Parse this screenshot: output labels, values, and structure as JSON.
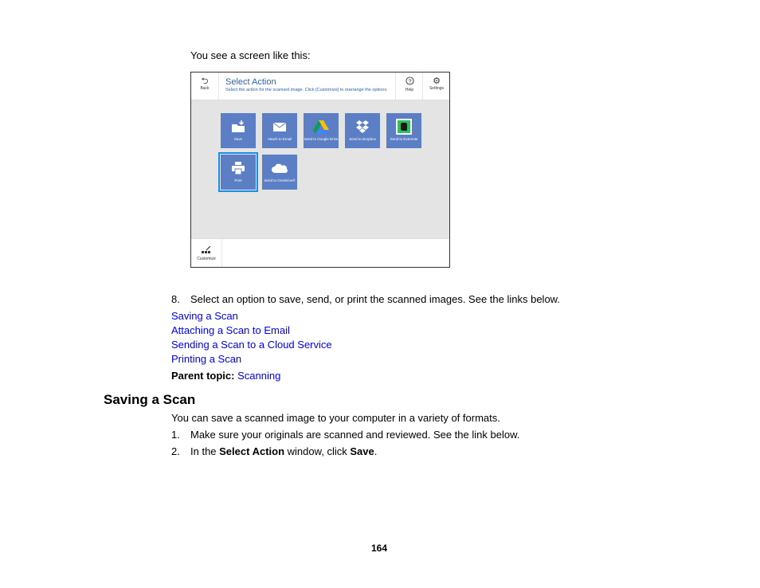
{
  "intro_text": "You see a screen like this:",
  "app": {
    "back_label": "Back",
    "title": "Select Action",
    "subtitle": "Select the action for the scanned image. Click [Customize] to rearrange the options.",
    "help_label": "Help",
    "settings_label": "Settings",
    "customize_label": "Customize",
    "icons": {
      "back": "back-arrow-icon",
      "help": "question-circle-icon",
      "settings": "gear-icon",
      "customize": "customize-icon"
    },
    "tile_color": "#5b7ec4",
    "selected_outline_color": "#1a8fe6",
    "actions": [
      {
        "label": "Save",
        "icon": "folder-add-icon",
        "selected": false
      },
      {
        "label": "Attach to Email",
        "icon": "envelope-icon",
        "selected": false
      },
      {
        "label": "Send to Google Drive",
        "icon": "google-drive-icon",
        "selected": false
      },
      {
        "label": "Send to Dropbox",
        "icon": "dropbox-icon",
        "selected": false
      },
      {
        "label": "Send to Evernote",
        "icon": "evernote-icon",
        "selected": false
      },
      {
        "label": "Print",
        "icon": "printer-icon",
        "selected": true
      },
      {
        "label": "Send to OneDrive®",
        "icon": "onedrive-cloud-icon",
        "selected": false
      }
    ]
  },
  "step8": {
    "number": "8.",
    "text": "Select an option to save, send, or print the scanned images. See the links below."
  },
  "links": [
    "Saving a Scan",
    "Attaching a Scan to Email",
    "Sending a Scan to a Cloud Service",
    "Printing a Scan"
  ],
  "parent_topic": {
    "label": "Parent topic:",
    "link": "Scanning"
  },
  "section": {
    "heading": "Saving a Scan",
    "intro": "You can save a scanned image to your computer in a variety of formats.",
    "step1": {
      "number": "1.",
      "text": "Make sure your originals are scanned and reviewed. See the link below."
    },
    "step2": {
      "number": "2.",
      "pre": "In the ",
      "bold1": "Select Action",
      "mid": " window, click ",
      "bold2": "Save",
      "post": "."
    }
  },
  "page_number": "164",
  "link_color": "#0000ee"
}
